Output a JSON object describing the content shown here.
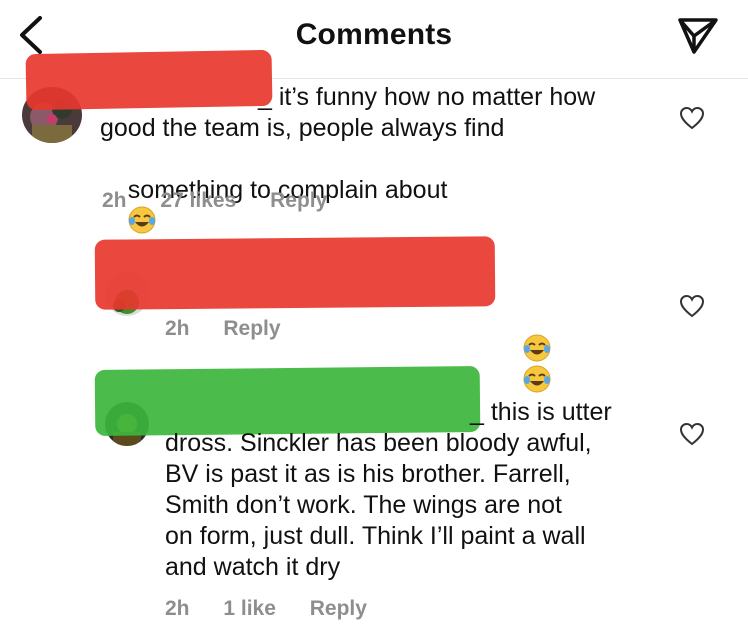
{
  "header": {
    "title": "Comments",
    "back_icon": "chevron-left-icon",
    "share_icon": "paper-plane-icon"
  },
  "comments": [
    {
      "text_line1": "_ it’s funny how no matter how",
      "text_line2": "good the team is, people always find",
      "text_line3": "something to complain about",
      "emoji": "face-with-tears-of-joy",
      "time": "2h",
      "likes": "27 likes",
      "reply": "Reply",
      "redaction_color": "#e8372e"
    },
    {
      "text_line1": "",
      "emoji": "face-with-tears-of-joy x2",
      "time": "2h",
      "reply": "Reply",
      "redaction_color": "#e8372e"
    },
    {
      "text_line1": "_ this is utter",
      "text_line2": "dross. Sinckler has been bloody awful,",
      "text_line3": "BV is past it as is his brother. Farrell,",
      "text_line4": "Smith don’t work. The wings are not",
      "text_line5": "on form, just dull. Think I’ll paint a wall",
      "text_line6": "and watch it dry",
      "time": "2h",
      "likes": "1 like",
      "reply": "Reply",
      "redaction_color": "#3cb63c"
    }
  ],
  "colors": {
    "meta_gray": "#8e8e8e",
    "divider": "#e4e4e4"
  }
}
